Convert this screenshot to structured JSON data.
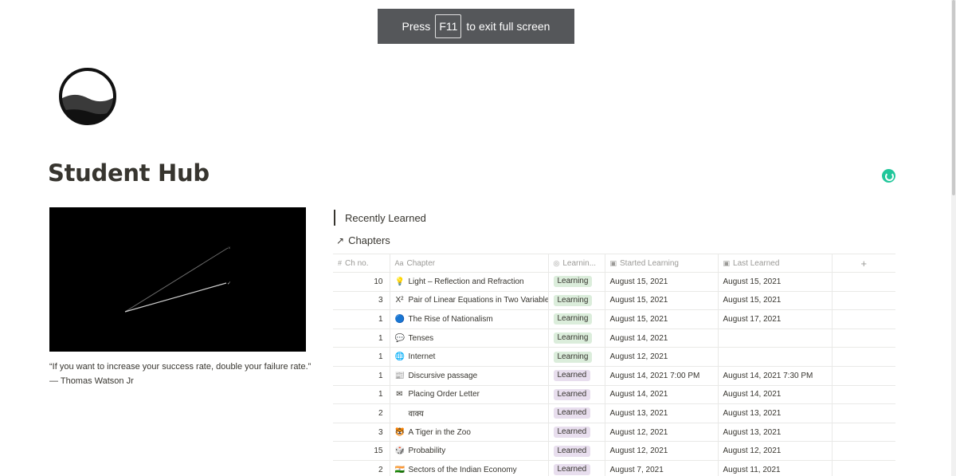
{
  "fullscreen_banner": {
    "prefix": "Press",
    "key": "F11",
    "suffix": "to exit full screen"
  },
  "page": {
    "title": "Student Hub"
  },
  "quote": "“If you want to increase your success rate, double your failure rate.” — Thomas Watson Jr",
  "sections": {
    "recently_learned": "Recently Learned",
    "database_title": "Chapters"
  },
  "table": {
    "columns": [
      {
        "icon": "#",
        "label": "Ch no."
      },
      {
        "icon": "Aa",
        "label": "Chapter"
      },
      {
        "icon": "◎",
        "label": "Learnin..."
      },
      {
        "icon": "▣",
        "label": "Started Learning"
      },
      {
        "icon": "▣",
        "label": "Last Learned"
      },
      {
        "icon": "",
        "label": "+"
      }
    ],
    "rows": [
      {
        "ch_no": "10",
        "emoji": "💡",
        "chapter": "Light – Reflection and Refraction",
        "status": "Learning",
        "started": "August 15, 2021",
        "last": "August 15, 2021"
      },
      {
        "ch_no": "3",
        "emoji": "X²",
        "chapter": "Pair of Linear Equations in Two Variables",
        "status": "Learning",
        "started": "August 15, 2021",
        "last": "August 15, 2021"
      },
      {
        "ch_no": "1",
        "emoji": "🔵",
        "chapter": "The Rise of Nationalism",
        "status": "Learning",
        "started": "August 15, 2021",
        "last": "August 17, 2021"
      },
      {
        "ch_no": "1",
        "emoji": "💬",
        "chapter": "Tenses",
        "status": "Learning",
        "started": "August 14, 2021",
        "last": ""
      },
      {
        "ch_no": "1",
        "emoji": "🌐",
        "chapter": "Internet",
        "status": "Learning",
        "started": "August 12, 2021",
        "last": ""
      },
      {
        "ch_no": "1",
        "emoji": "📰",
        "chapter": "Discursive passage",
        "status": "Learned",
        "started": "August 14, 2021 7:00 PM",
        "last": "August 14, 2021 7:30 PM"
      },
      {
        "ch_no": "1",
        "emoji": "✉",
        "chapter": "Placing Order Letter",
        "status": "Learned",
        "started": "August 14, 2021",
        "last": "August 14, 2021"
      },
      {
        "ch_no": "2",
        "emoji": "",
        "chapter": "वाक्य",
        "status": "Learned",
        "started": "August 13, 2021",
        "last": "August 13, 2021"
      },
      {
        "ch_no": "3",
        "emoji": "🐯",
        "chapter": "A Tiger in the Zoo",
        "status": "Learned",
        "started": "August 12, 2021",
        "last": "August 13, 2021"
      },
      {
        "ch_no": "15",
        "emoji": "🎲",
        "chapter": "Probability",
        "status": "Learned",
        "started": "August 12, 2021",
        "last": "August 12, 2021"
      },
      {
        "ch_no": "2",
        "emoji": "🇮🇳",
        "chapter": "Sectors of the Indian Economy",
        "status": "Learned",
        "started": "August 7, 2021",
        "last": "August 11, 2021"
      }
    ]
  },
  "colors": {
    "tag_learning": "#dbeddb",
    "tag_learned": "#e8deee",
    "sync_indicator": "#21c79b"
  }
}
